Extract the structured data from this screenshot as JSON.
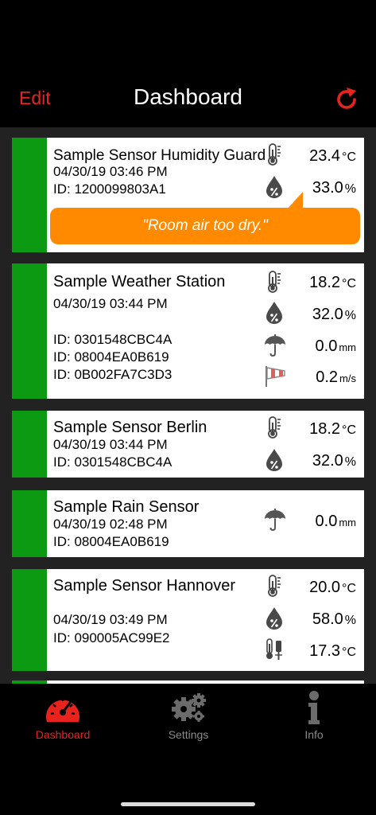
{
  "header": {
    "edit_label": "Edit",
    "title": "Dashboard",
    "refresh_icon": "refresh-icon"
  },
  "colors": {
    "accent": "#e8231e",
    "status_ok": "#0b9a11",
    "alert": "#ff8a00"
  },
  "sensors": [
    {
      "name": "Sample Sensor Humidity Guard",
      "datetime": "04/30/19  03:46 PM",
      "ids": [
        "ID: 1200099803A1"
      ],
      "readings": [
        {
          "icon": "thermometer-icon",
          "value": "23.4",
          "unit": "°C"
        },
        {
          "icon": "humidity-drop-icon",
          "value": "33.0",
          "unit": "%"
        }
      ],
      "alert": "\"Room air too dry.\""
    },
    {
      "name": "Sample Weather Station",
      "datetime": "04/30/19  03:44 PM",
      "ids": [
        "ID: 0301548CBC4A",
        "ID: 08004EA0B619",
        "ID: 0B002FA7C3D3"
      ],
      "readings": [
        {
          "icon": "thermometer-icon",
          "value": "18.2",
          "unit": "°C"
        },
        {
          "icon": "humidity-drop-icon",
          "value": "32.0",
          "unit": "%"
        },
        {
          "icon": "umbrella-icon",
          "value": "0.0",
          "unit": "mm"
        },
        {
          "icon": "windsock-icon",
          "value": "0.2",
          "unit": "m/s"
        }
      ]
    },
    {
      "name": "Sample Sensor Berlin",
      "datetime": "04/30/19  03:44 PM",
      "ids": [
        "ID: 0301548CBC4A"
      ],
      "readings": [
        {
          "icon": "thermometer-icon",
          "value": "18.2",
          "unit": "°C"
        },
        {
          "icon": "humidity-drop-icon",
          "value": "32.0",
          "unit": "%"
        }
      ]
    },
    {
      "name": "Sample Rain Sensor",
      "datetime": "04/30/19  02:48 PM",
      "ids": [
        "ID: 08004EA0B619"
      ],
      "readings": [
        {
          "icon": "umbrella-icon",
          "value": "0.0",
          "unit": "mm"
        }
      ]
    },
    {
      "name": "Sample Sensor Hannover",
      "datetime": "04/30/19  03:49 PM",
      "ids": [
        "ID: 090005AC99E2"
      ],
      "readings": [
        {
          "icon": "thermometer-icon",
          "value": "20.0",
          "unit": "°C"
        },
        {
          "icon": "humidity-drop-icon",
          "value": "58.0",
          "unit": "%"
        },
        {
          "icon": "probe-thermometer-icon",
          "value": "17.3",
          "unit": "°C"
        }
      ]
    }
  ],
  "tabs": [
    {
      "label": "Dashboard",
      "icon": "dashboard-gauge-icon",
      "active": true
    },
    {
      "label": "Settings",
      "icon": "gears-icon",
      "active": false
    },
    {
      "label": "Info",
      "icon": "info-icon",
      "active": false
    }
  ]
}
